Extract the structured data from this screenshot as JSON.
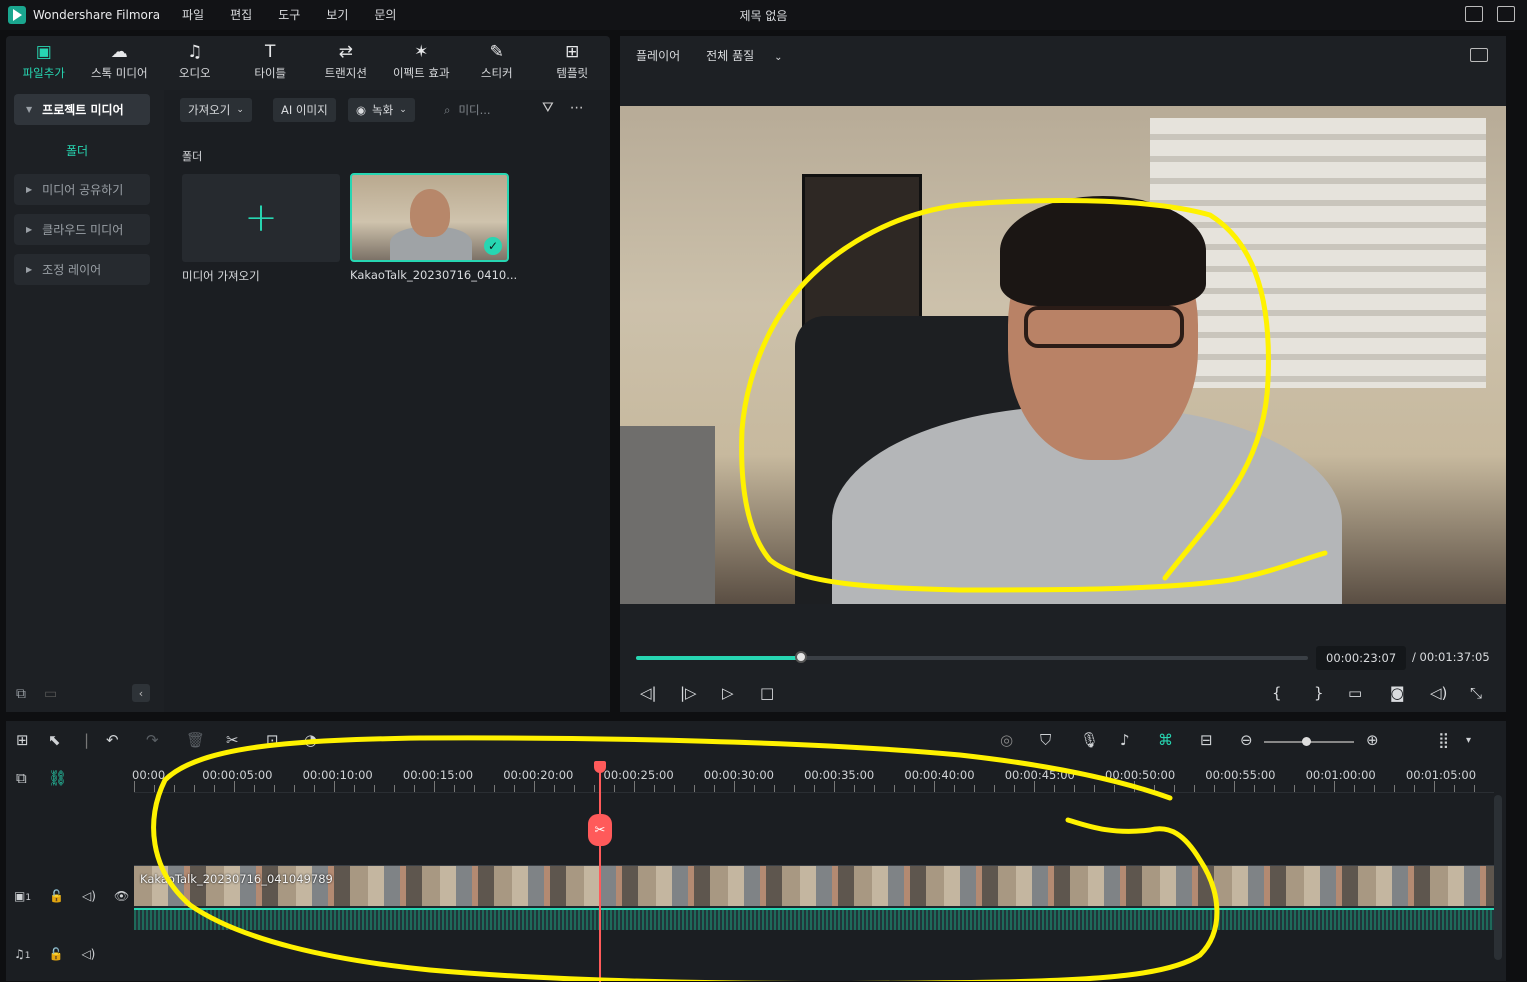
{
  "app": {
    "name": "Wondershare Filmora",
    "title": "제목 없음"
  },
  "menu": [
    "파일",
    "편집",
    "도구",
    "보기",
    "문의"
  ],
  "tabs": [
    {
      "label": "파일추가",
      "icon": "media-icon",
      "glyph": "▣"
    },
    {
      "label": "스톡 미디어",
      "icon": "cloud-icon",
      "glyph": "☁"
    },
    {
      "label": "오디오",
      "icon": "music-note-icon",
      "glyph": "♫"
    },
    {
      "label": "타이틀",
      "icon": "title-t-icon",
      "glyph": "T"
    },
    {
      "label": "트랜지션",
      "icon": "transition-icon",
      "glyph": "⇄"
    },
    {
      "label": "이펙트 효과",
      "icon": "effects-star-icon",
      "glyph": "✶"
    },
    {
      "label": "스티커",
      "icon": "sticker-icon",
      "glyph": "✎"
    },
    {
      "label": "템플릿",
      "icon": "template-icon",
      "glyph": "⊞"
    }
  ],
  "sidebar": {
    "project_media": "프로젝트 미디어",
    "folder": "폴더",
    "items": [
      "미디어 공유하기",
      "클라우드 미디어",
      "조정 레이어"
    ]
  },
  "media": {
    "import_btn": "가져오기",
    "ai_image": "AI 이미지",
    "record": "녹화",
    "search_placeholder": "미디...",
    "folder_label": "폴더",
    "import_media": "미디어 가져오기",
    "clip_name": "KakaoTalk_20230716_0410..."
  },
  "player": {
    "label": "플레이어",
    "quality": "전체 품질",
    "current_time": "00:00:23:07",
    "total_time": "/ 00:01:37:05",
    "progress": 0.245
  },
  "timeline": {
    "ruler": [
      "00:00",
      "00:00:05:00",
      "00:00:10:00",
      "00:00:15:00",
      "00:00:20:00",
      "00:00:25:00",
      "00:00:30:00",
      "00:00:35:00",
      "00:00:40:00",
      "00:00:45:00",
      "00:00:50:00",
      "00:00:55:00",
      "00:01:00:00",
      "00:01:05:00"
    ],
    "clip_label": "KakaoTalk_20230716_041049789",
    "video_track": "1",
    "audio_track": "1"
  },
  "colors": {
    "accent": "#27d6b2",
    "playhead": "#ff5a5a",
    "annotation": "#fff200"
  }
}
